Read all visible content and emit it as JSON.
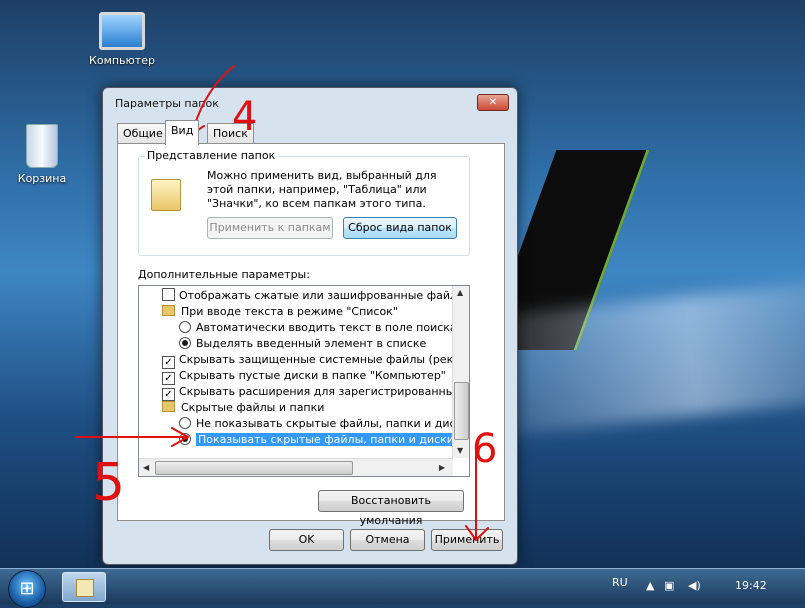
{
  "desktop": {
    "icons": [
      {
        "label": "Компьютер",
        "icon": "computer-icon"
      },
      {
        "label": "Корзина",
        "icon": "recycle-bin-icon"
      }
    ]
  },
  "dialog": {
    "title": "Параметры папок",
    "close_label": "✕",
    "tabs": [
      {
        "label": "Общие",
        "active": false
      },
      {
        "label": "Вид",
        "active": true
      },
      {
        "label": "Поиск",
        "active": false
      }
    ],
    "folder_views": {
      "group_title": "Представление папок",
      "description": "Можно применить вид, выбранный для этой папки, например, \"Таблица\" или \"Значки\", ко всем папкам этого типа.",
      "apply_button": "Применить к папкам",
      "reset_button": "Сброс вида папок"
    },
    "advanced": {
      "label": "Дополнительные параметры:",
      "items": [
        {
          "kind": "checkbox",
          "checked": false,
          "text": "Отображать сжатые или зашифрованные файлы NTFS"
        },
        {
          "kind": "folder",
          "text": "При вводе текста в режиме \"Список\""
        },
        {
          "kind": "radio",
          "checked": false,
          "text": "Автоматически вводить текст в поле поиска"
        },
        {
          "kind": "radio",
          "checked": true,
          "text": "Выделять введенный элемент в списке"
        },
        {
          "kind": "checkbox",
          "checked": true,
          "text": "Скрывать защищенные системные файлы (рекомендуется)"
        },
        {
          "kind": "checkbox",
          "checked": true,
          "text": "Скрывать пустые диски в папке \"Компьютер\""
        },
        {
          "kind": "checkbox",
          "checked": true,
          "text": "Скрывать расширения для зарегистрированных типов файлов"
        },
        {
          "kind": "folder",
          "text": "Скрытые файлы и папки"
        },
        {
          "kind": "radio",
          "checked": false,
          "text": "Не показывать скрытые файлы, папки и диски"
        },
        {
          "kind": "radio",
          "checked": true,
          "selected": true,
          "text": "Показывать скрытые файлы, папки и диски"
        }
      ]
    },
    "restore_button": "Восстановить умолчания",
    "ok_button": "OK",
    "cancel_button": "Отмена",
    "apply_button": "Применить"
  },
  "annotations": {
    "step_tab": "4",
    "step_option": "5",
    "step_apply": "6"
  },
  "taskbar": {
    "language": "RU",
    "clock": "19:42"
  }
}
